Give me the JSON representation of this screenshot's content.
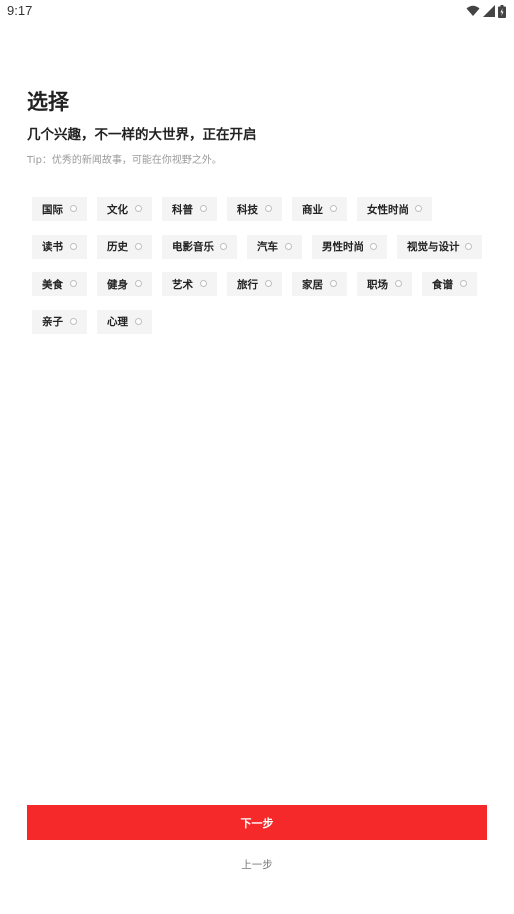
{
  "status_bar": {
    "time": "9:17",
    "icons": [
      "wifi-icon",
      "signal-icon",
      "battery-icon"
    ]
  },
  "header": {
    "title": "选择",
    "subtitle": "几个兴趣，不一样的大世界，正在开启",
    "tip": "Tip：优秀的新闻故事，可能在你视野之外。"
  },
  "tags": [
    [
      "国际",
      "文化",
      "科普",
      "科技",
      "商业",
      "女性时尚"
    ],
    [
      "读书",
      "历史",
      "电影音乐",
      "汽车",
      "男性时尚",
      "视觉与设计"
    ],
    [
      "美食",
      "健身",
      "艺术",
      "旅行",
      "家居",
      "职场",
      "食谱"
    ],
    [
      "亲子",
      "心理"
    ]
  ],
  "footer": {
    "next_label": "下一步",
    "prev_label": "上一步"
  },
  "colors": {
    "accent": "#f5282a",
    "tag_bg": "#f4f4f4",
    "tip_text": "#9a9a9a"
  }
}
